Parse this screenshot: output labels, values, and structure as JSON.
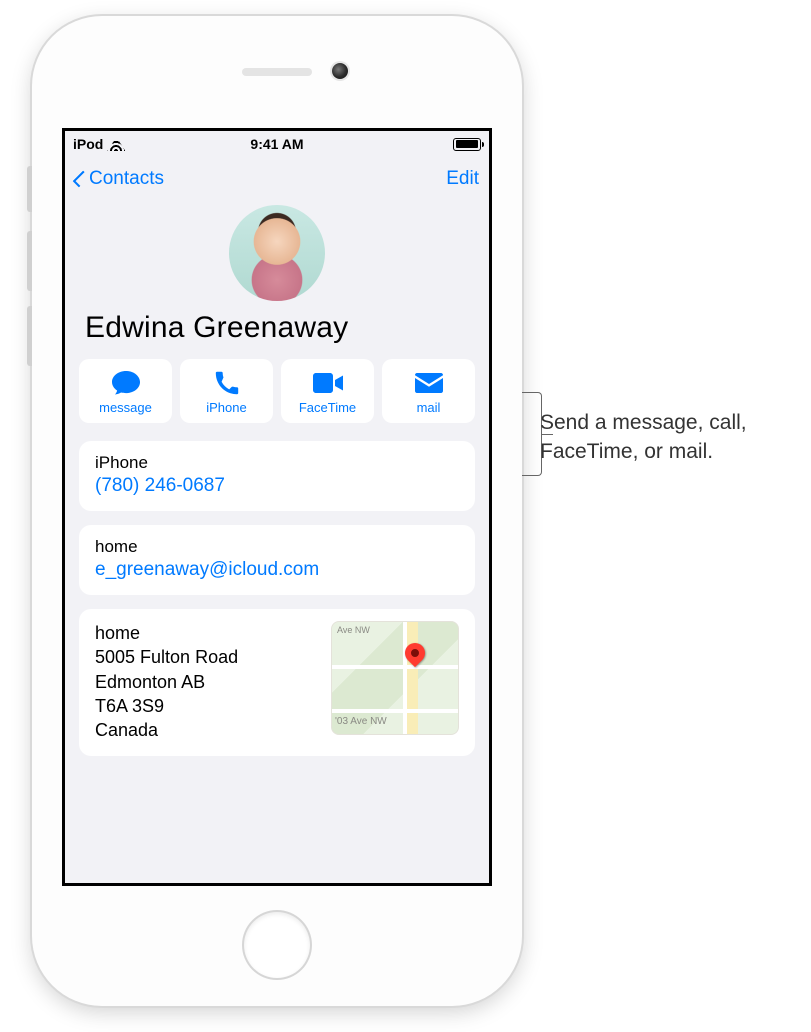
{
  "status": {
    "device": "iPod",
    "time": "9:41 AM"
  },
  "nav": {
    "back": "Contacts",
    "edit": "Edit"
  },
  "contact": {
    "name": "Edwina Greenaway"
  },
  "actions": {
    "message": "message",
    "call": "iPhone",
    "facetime": "FaceTime",
    "mail": "mail"
  },
  "phone": {
    "label": "iPhone",
    "value": "(780) 246-0687"
  },
  "email": {
    "label": "home",
    "value": "e_greenaway@icloud.com"
  },
  "address": {
    "label": "home",
    "line1": "5005 Fulton Road",
    "line2": "Edmonton AB",
    "line3": "T6A 3S9",
    "line4": "Canada",
    "map_top": "Ave NW",
    "map_bot": "'03 Ave NW"
  },
  "callout": {
    "line1": "Send a message, call,",
    "line2": "FaceTime, or mail."
  }
}
